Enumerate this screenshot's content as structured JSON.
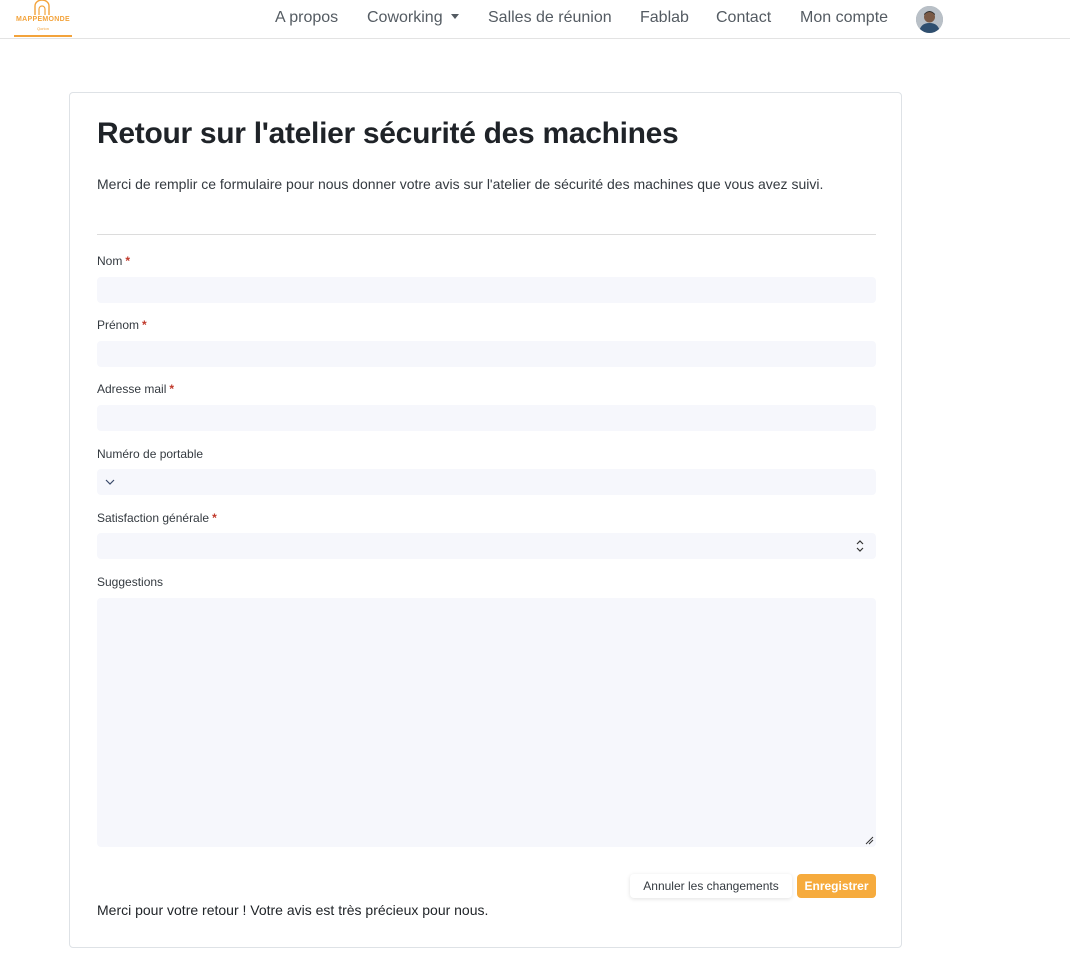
{
  "brand": {
    "logo_text": "MAPPEMONDE",
    "logo_sub": "Qorion",
    "color": "#f3a33b"
  },
  "nav": {
    "items": [
      {
        "label": "A propos"
      },
      {
        "label": "Coworking"
      },
      {
        "label": "Salles de réunion"
      },
      {
        "label": "Fablab"
      },
      {
        "label": "Contact"
      },
      {
        "label": "Mon compte"
      }
    ]
  },
  "form": {
    "title": "Retour sur l'atelier sécurité des machines",
    "description": "Merci de remplir ce formulaire pour nous donner votre avis sur l'atelier de sécurité des machines que vous avez suivi.",
    "required_marker": "*",
    "fields": {
      "nom": {
        "label": "Nom",
        "value": ""
      },
      "prenom": {
        "label": "Prénom",
        "value": ""
      },
      "email": {
        "label": "Adresse mail",
        "value": ""
      },
      "phone": {
        "label": "Numéro de portable",
        "value": "",
        "icon": "chevron-down-icon"
      },
      "satisfaction": {
        "label": "Satisfaction générale",
        "value": ""
      },
      "suggestions": {
        "label": "Suggestions",
        "value": ""
      }
    },
    "buttons": {
      "cancel": "Annuler les changements",
      "save": "Enregistrer"
    },
    "thanks": "Merci pour votre retour ! Votre avis est très précieux pour nous."
  },
  "colors": {
    "accent": "#f6ab3d",
    "required": "#c0392b",
    "input_bg": "#f6f7fc"
  }
}
